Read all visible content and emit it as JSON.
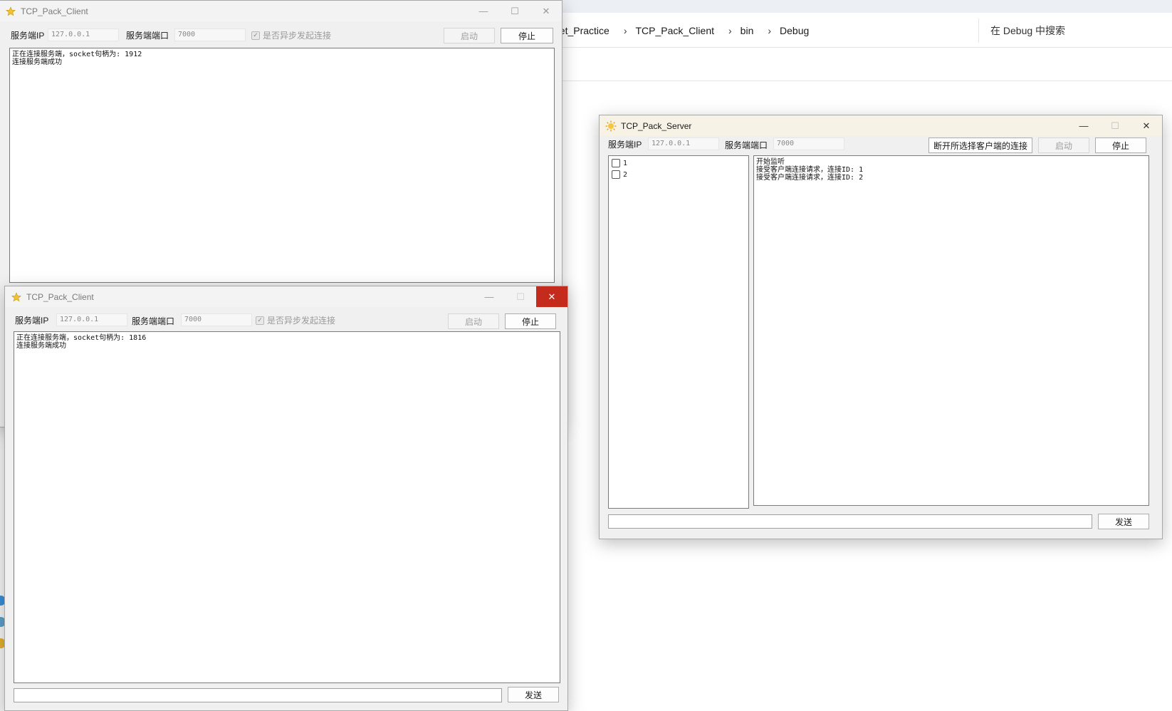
{
  "explorer": {
    "breadcrumbs": [
      "ocket_Practice",
      "TCP_Pack_Client",
      "bin",
      "Debug"
    ],
    "search_placeholder": "在 Debug 中搜索"
  },
  "client1": {
    "title": "TCP_Pack_Client",
    "ip_label": "服务端IP",
    "ip_value": "127.0.0.1",
    "port_label": "服务端端口",
    "port_value": "7000",
    "async_label": "是否异步发起连接",
    "start_label": "启动",
    "stop_label": "停止",
    "log": [
      "正在连接服务端，socket句柄为: 1912",
      "连接服务端成功"
    ]
  },
  "client2": {
    "title": "TCP_Pack_Client",
    "ip_label": "服务端IP",
    "ip_value": "127.0.0.1",
    "port_label": "服务端端口",
    "port_value": "7000",
    "async_label": "是否异步发起连接",
    "start_label": "启动",
    "stop_label": "停止",
    "log": [
      "正在连接服务端，socket句柄为: 1816",
      "连接服务端成功"
    ],
    "send_label": "发送"
  },
  "server": {
    "title": "TCP_Pack_Server",
    "ip_label": "服务端IP",
    "ip_value": "127.0.0.1",
    "port_label": "服务端端口",
    "port_value": "7000",
    "disconnect_label": "断开所选择客户端的连接",
    "start_label": "启动",
    "stop_label": "停止",
    "clients": [
      "1",
      "2"
    ],
    "log": [
      "开始监听",
      "接受客户端连接请求，连接ID: 1",
      "接受客户端连接请求，连接ID: 2"
    ],
    "send_label": "发送"
  },
  "colors": {
    "close_red": "#c42b1c",
    "active_title": "#f7f2e6",
    "window_bg": "#f0f0f0"
  }
}
